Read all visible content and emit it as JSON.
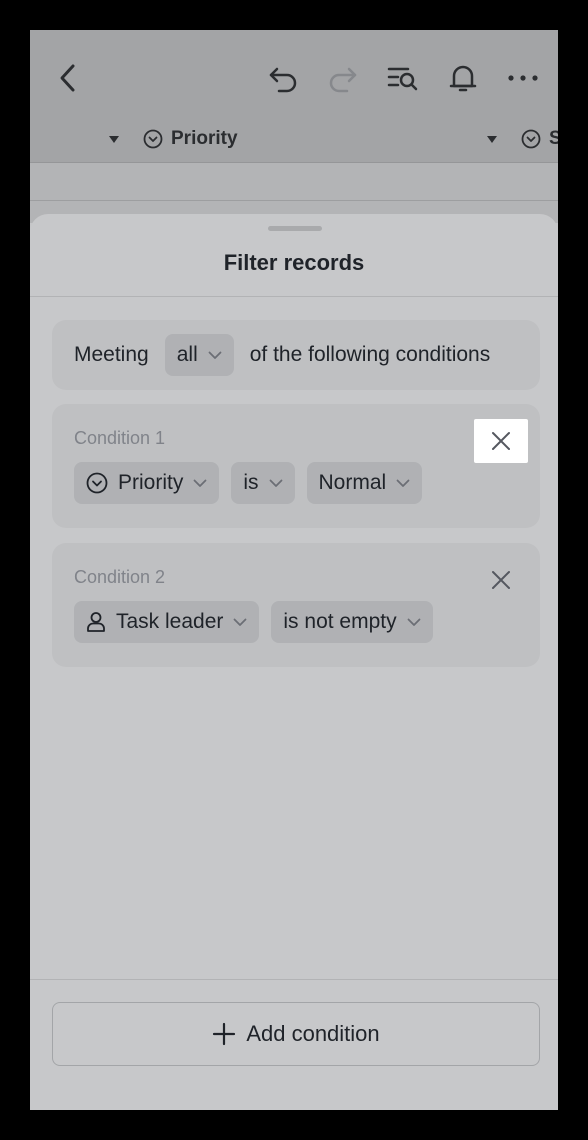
{
  "background": {
    "column_header": {
      "field_label": "Priority",
      "next_field_label": "S"
    }
  },
  "sheet": {
    "title": "Filter records",
    "match": {
      "prefix": "Meeting",
      "mode": "all",
      "suffix": "of the following conditions"
    },
    "conditions": [
      {
        "title": "Condition 1",
        "field": "Priority",
        "field_icon": "circle-chevron-icon",
        "operator": "is",
        "value": "Normal"
      },
      {
        "title": "Condition 2",
        "field": "Task leader",
        "field_icon": "person-icon",
        "operator": "is not empty"
      }
    ],
    "add_condition_label": "Add condition"
  },
  "colors": {
    "overlay_dim": "#a3a4a6",
    "sheet_bg": "#c7c8ca",
    "card_bg": "#bfc0c2",
    "pill_bg": "#b0b1b4",
    "highlight": "#ffffff"
  }
}
